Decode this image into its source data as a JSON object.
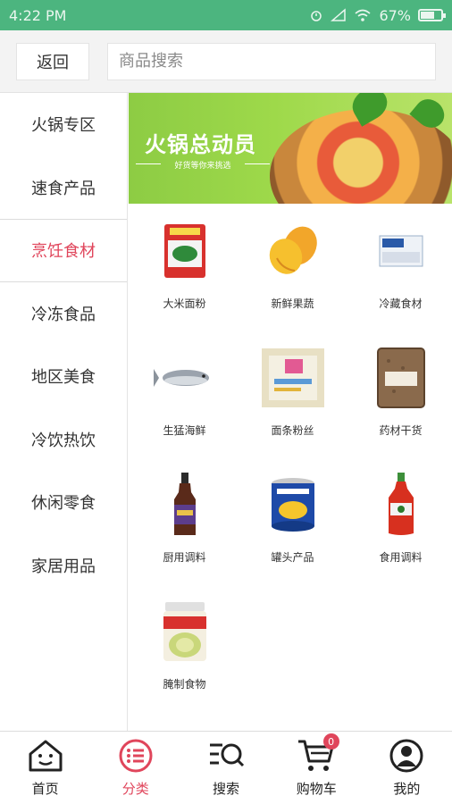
{
  "status_bar": {
    "time": "4:22 PM",
    "battery": "67%",
    "icons": [
      "alarm-icon",
      "signal-icon",
      "wifi-icon",
      "battery-icon"
    ],
    "battery_level": 0.67
  },
  "header": {
    "back_label": "返回",
    "search_placeholder": "商品搜索"
  },
  "sidebar": {
    "items": [
      {
        "label": "火锅专区"
      },
      {
        "label": "速食产品"
      },
      {
        "label": "烹饪食材"
      },
      {
        "label": "冷冻食品"
      },
      {
        "label": "地区美食"
      },
      {
        "label": "冷饮热饮"
      },
      {
        "label": "休闲零食"
      },
      {
        "label": "家居用品"
      }
    ],
    "active_index": 2
  },
  "banner": {
    "title": "火锅总动员",
    "subtitle": "好货等你来挑选"
  },
  "products": [
    {
      "label": "大米面粉",
      "icon": "flour-bag-icon"
    },
    {
      "label": "新鲜果蔬",
      "icon": "mango-icon"
    },
    {
      "label": "冷藏食材",
      "icon": "tofu-pack-icon"
    },
    {
      "label": "生猛海鲜",
      "icon": "fish-icon"
    },
    {
      "label": "面条粉丝",
      "icon": "noodle-pack-icon"
    },
    {
      "label": "药材干货",
      "icon": "grain-bag-icon"
    },
    {
      "label": "厨用调料",
      "icon": "sauce-bottle-icon"
    },
    {
      "label": "罐头产品",
      "icon": "can-icon"
    },
    {
      "label": "食用调料",
      "icon": "sriracha-bottle-icon"
    },
    {
      "label": "腌制食物",
      "icon": "pickle-jar-icon"
    }
  ],
  "tabbar": {
    "items": [
      {
        "label": "首页",
        "icon": "home-icon"
      },
      {
        "label": "分类",
        "icon": "category-icon"
      },
      {
        "label": "搜索",
        "icon": "search-icon"
      },
      {
        "label": "购物车",
        "icon": "cart-icon"
      },
      {
        "label": "我的",
        "icon": "profile-icon"
      }
    ],
    "active_index": 1,
    "cart_badge": "0"
  },
  "colors": {
    "status_bar": "#4cb57f",
    "accent": "#e0455b",
    "banner_green": "#9ed94a"
  }
}
